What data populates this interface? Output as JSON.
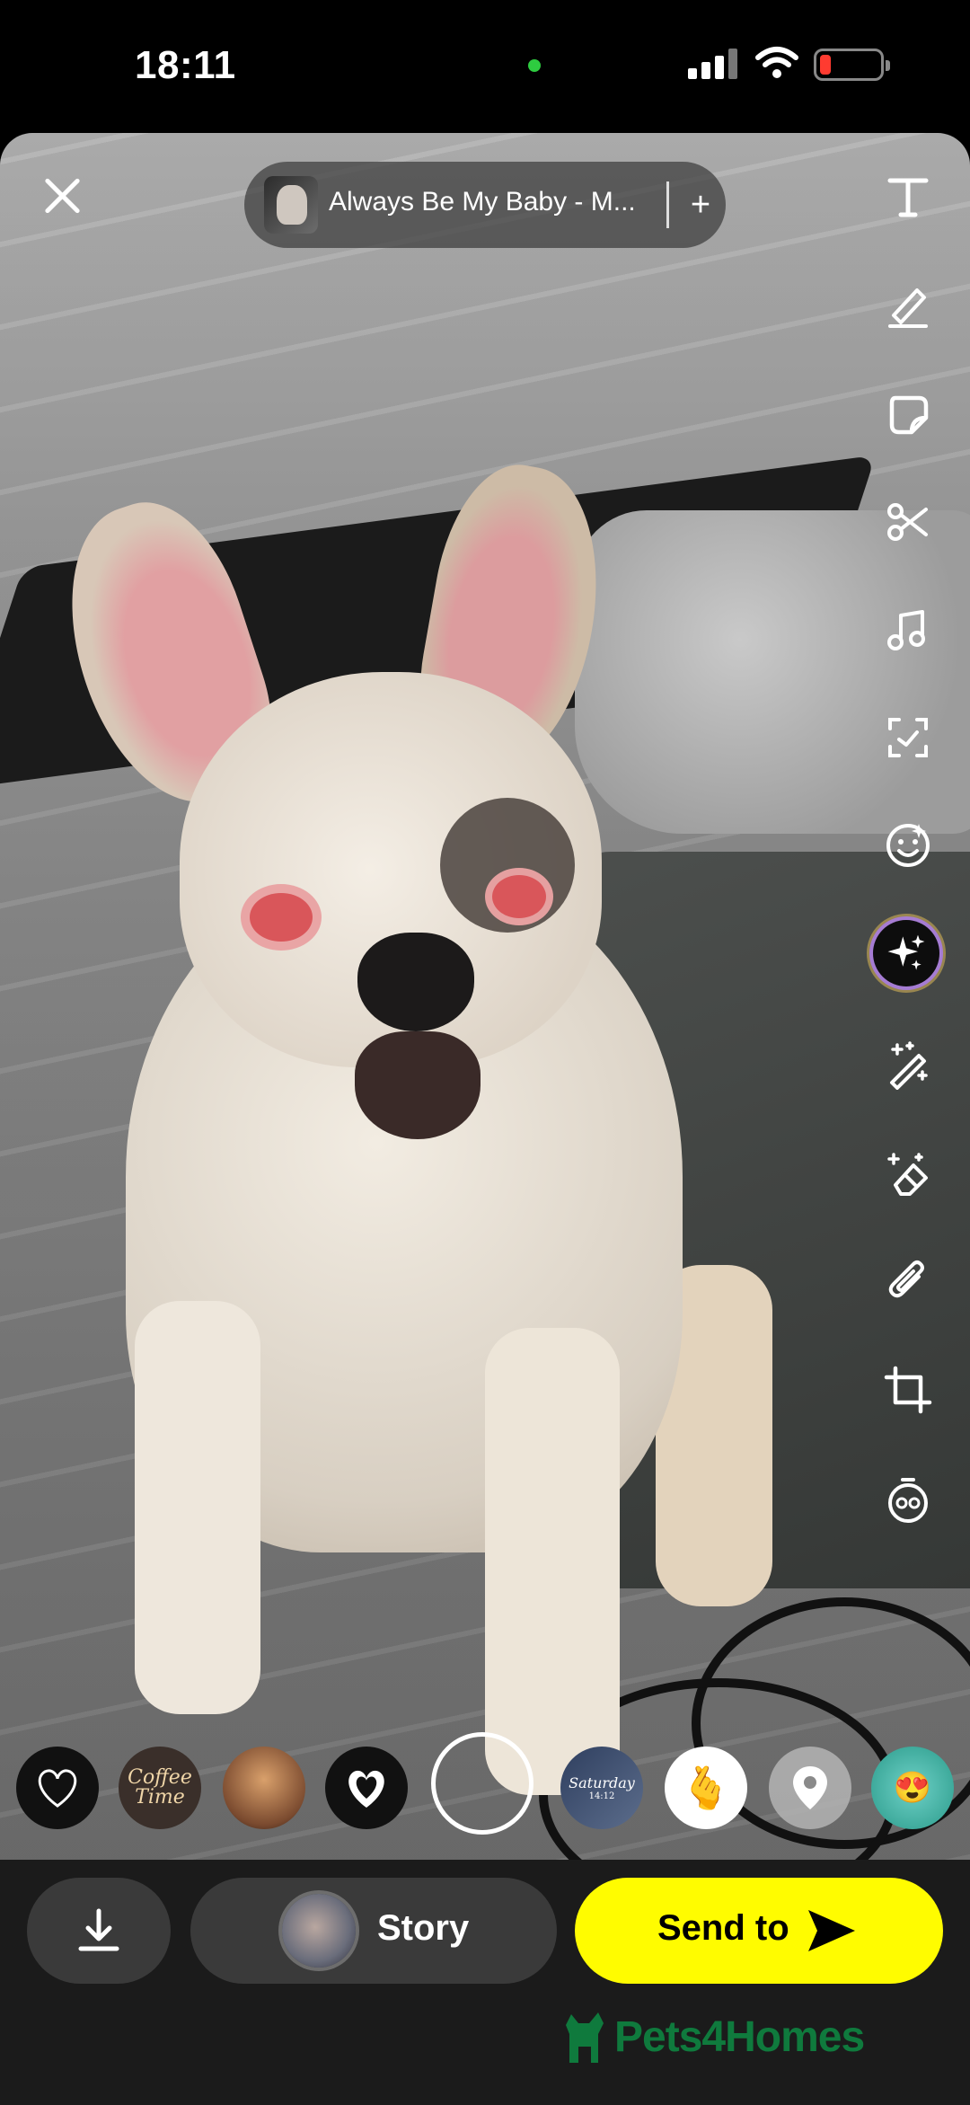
{
  "status_bar": {
    "time": "18:11",
    "camera_dot_color": "#2ecc40",
    "battery_color": "#ff3b30"
  },
  "editor": {
    "close_icon": "close-icon",
    "music": {
      "title": "Always Be My Baby - M...",
      "add_label": "+"
    },
    "tools": [
      "text-icon",
      "pencil-icon",
      "sticker-icon",
      "scissors-icon",
      "music-note-icon",
      "scan-icon",
      "lens-face-icon",
      "ai-sparkle-icon",
      "magic-wand-icon",
      "eraser-icon",
      "paperclip-icon",
      "crop-icon",
      "timer-icon"
    ]
  },
  "stickers": {
    "coffee_text": "Coffee Time",
    "saturday_text": "Saturday",
    "saturday_time": "14:12",
    "finger_heart": "🫰",
    "emoji_pack": "😍"
  },
  "bottom_bar": {
    "story_label": "Story",
    "send_label": "Send to",
    "send_color": "#fffc00"
  },
  "watermark": {
    "text": "Pets4Homes",
    "color": "#0f7a3d"
  }
}
